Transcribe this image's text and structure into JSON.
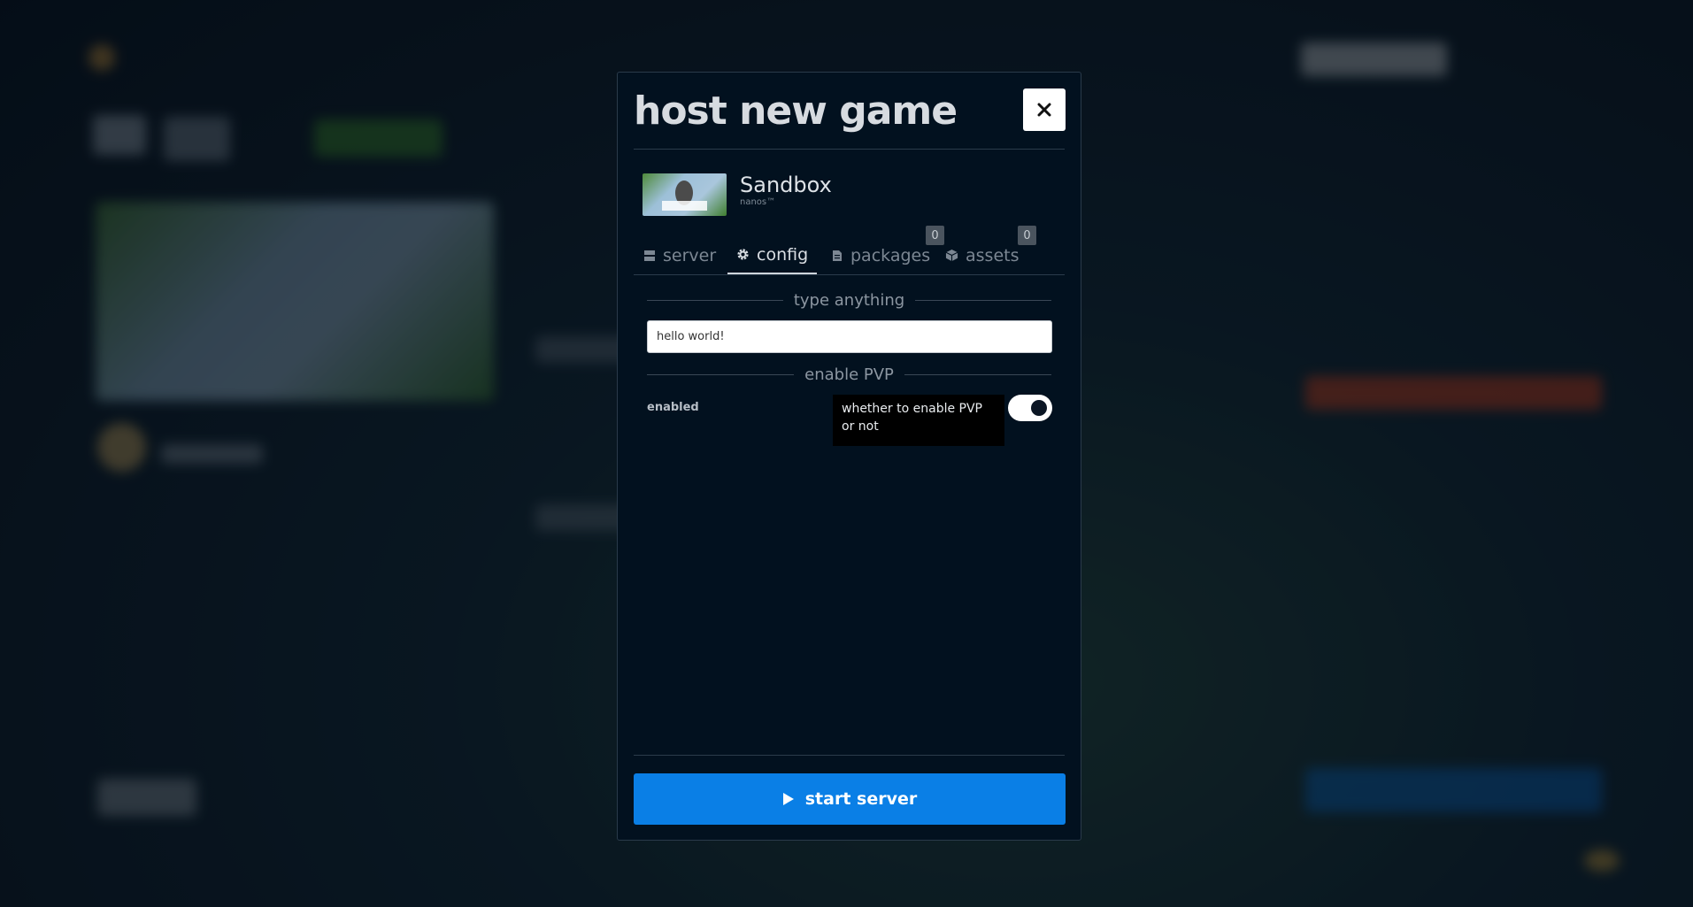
{
  "modal": {
    "title": "host new game",
    "game": {
      "name": "Sandbox",
      "author": "nanos™",
      "thumbnail_label": "SANDBOX"
    },
    "tabs": [
      {
        "label": "server",
        "icon": "server-icon",
        "active": false
      },
      {
        "label": "config",
        "icon": "gear-icon",
        "active": true
      },
      {
        "label": "packages",
        "icon": "file-icon",
        "badge": "0",
        "active": false
      },
      {
        "label": "assets",
        "icon": "box-icon",
        "badge": "0",
        "active": false
      }
    ],
    "config": {
      "text_section": "type anything",
      "text_value": "hello world!",
      "pvp_section": "enable PVP",
      "pvp_label": "enabled",
      "pvp_tooltip": "whether to enable PVP or not",
      "pvp_enabled": true
    },
    "start_button": "start server"
  },
  "colors": {
    "modal_bg": "#02111f",
    "accent": "#0a7fe6",
    "tooltip_bg": "#000000"
  }
}
